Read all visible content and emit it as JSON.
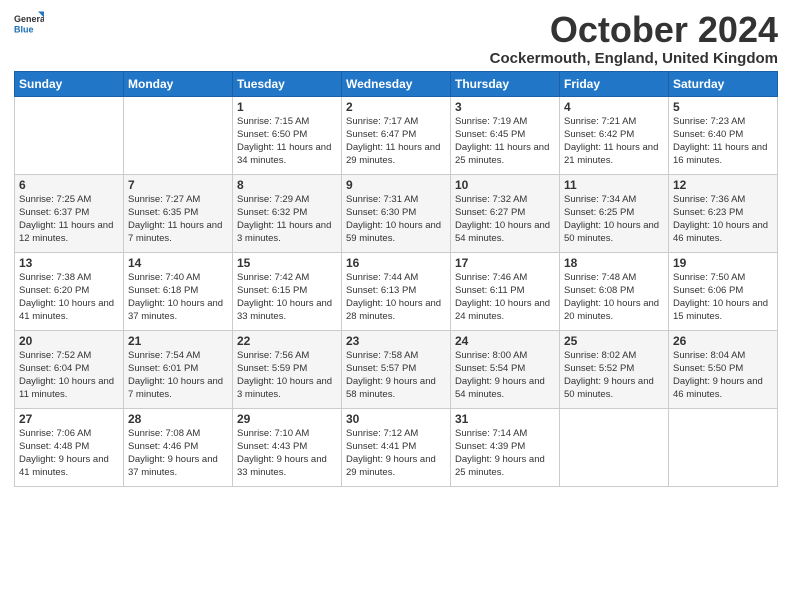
{
  "logo": {
    "line1": "General",
    "line2": "Blue"
  },
  "title": "October 2024",
  "location": "Cockermouth, England, United Kingdom",
  "days_header": [
    "Sunday",
    "Monday",
    "Tuesday",
    "Wednesday",
    "Thursday",
    "Friday",
    "Saturday"
  ],
  "weeks": [
    [
      {
        "day": "",
        "sunrise": "",
        "sunset": "",
        "daylight": ""
      },
      {
        "day": "",
        "sunrise": "",
        "sunset": "",
        "daylight": ""
      },
      {
        "day": "1",
        "sunrise": "Sunrise: 7:15 AM",
        "sunset": "Sunset: 6:50 PM",
        "daylight": "Daylight: 11 hours and 34 minutes."
      },
      {
        "day": "2",
        "sunrise": "Sunrise: 7:17 AM",
        "sunset": "Sunset: 6:47 PM",
        "daylight": "Daylight: 11 hours and 29 minutes."
      },
      {
        "day": "3",
        "sunrise": "Sunrise: 7:19 AM",
        "sunset": "Sunset: 6:45 PM",
        "daylight": "Daylight: 11 hours and 25 minutes."
      },
      {
        "day": "4",
        "sunrise": "Sunrise: 7:21 AM",
        "sunset": "Sunset: 6:42 PM",
        "daylight": "Daylight: 11 hours and 21 minutes."
      },
      {
        "day": "5",
        "sunrise": "Sunrise: 7:23 AM",
        "sunset": "Sunset: 6:40 PM",
        "daylight": "Daylight: 11 hours and 16 minutes."
      }
    ],
    [
      {
        "day": "6",
        "sunrise": "Sunrise: 7:25 AM",
        "sunset": "Sunset: 6:37 PM",
        "daylight": "Daylight: 11 hours and 12 minutes."
      },
      {
        "day": "7",
        "sunrise": "Sunrise: 7:27 AM",
        "sunset": "Sunset: 6:35 PM",
        "daylight": "Daylight: 11 hours and 7 minutes."
      },
      {
        "day": "8",
        "sunrise": "Sunrise: 7:29 AM",
        "sunset": "Sunset: 6:32 PM",
        "daylight": "Daylight: 11 hours and 3 minutes."
      },
      {
        "day": "9",
        "sunrise": "Sunrise: 7:31 AM",
        "sunset": "Sunset: 6:30 PM",
        "daylight": "Daylight: 10 hours and 59 minutes."
      },
      {
        "day": "10",
        "sunrise": "Sunrise: 7:32 AM",
        "sunset": "Sunset: 6:27 PM",
        "daylight": "Daylight: 10 hours and 54 minutes."
      },
      {
        "day": "11",
        "sunrise": "Sunrise: 7:34 AM",
        "sunset": "Sunset: 6:25 PM",
        "daylight": "Daylight: 10 hours and 50 minutes."
      },
      {
        "day": "12",
        "sunrise": "Sunrise: 7:36 AM",
        "sunset": "Sunset: 6:23 PM",
        "daylight": "Daylight: 10 hours and 46 minutes."
      }
    ],
    [
      {
        "day": "13",
        "sunrise": "Sunrise: 7:38 AM",
        "sunset": "Sunset: 6:20 PM",
        "daylight": "Daylight: 10 hours and 41 minutes."
      },
      {
        "day": "14",
        "sunrise": "Sunrise: 7:40 AM",
        "sunset": "Sunset: 6:18 PM",
        "daylight": "Daylight: 10 hours and 37 minutes."
      },
      {
        "day": "15",
        "sunrise": "Sunrise: 7:42 AM",
        "sunset": "Sunset: 6:15 PM",
        "daylight": "Daylight: 10 hours and 33 minutes."
      },
      {
        "day": "16",
        "sunrise": "Sunrise: 7:44 AM",
        "sunset": "Sunset: 6:13 PM",
        "daylight": "Daylight: 10 hours and 28 minutes."
      },
      {
        "day": "17",
        "sunrise": "Sunrise: 7:46 AM",
        "sunset": "Sunset: 6:11 PM",
        "daylight": "Daylight: 10 hours and 24 minutes."
      },
      {
        "day": "18",
        "sunrise": "Sunrise: 7:48 AM",
        "sunset": "Sunset: 6:08 PM",
        "daylight": "Daylight: 10 hours and 20 minutes."
      },
      {
        "day": "19",
        "sunrise": "Sunrise: 7:50 AM",
        "sunset": "Sunset: 6:06 PM",
        "daylight": "Daylight: 10 hours and 15 minutes."
      }
    ],
    [
      {
        "day": "20",
        "sunrise": "Sunrise: 7:52 AM",
        "sunset": "Sunset: 6:04 PM",
        "daylight": "Daylight: 10 hours and 11 minutes."
      },
      {
        "day": "21",
        "sunrise": "Sunrise: 7:54 AM",
        "sunset": "Sunset: 6:01 PM",
        "daylight": "Daylight: 10 hours and 7 minutes."
      },
      {
        "day": "22",
        "sunrise": "Sunrise: 7:56 AM",
        "sunset": "Sunset: 5:59 PM",
        "daylight": "Daylight: 10 hours and 3 minutes."
      },
      {
        "day": "23",
        "sunrise": "Sunrise: 7:58 AM",
        "sunset": "Sunset: 5:57 PM",
        "daylight": "Daylight: 9 hours and 58 minutes."
      },
      {
        "day": "24",
        "sunrise": "Sunrise: 8:00 AM",
        "sunset": "Sunset: 5:54 PM",
        "daylight": "Daylight: 9 hours and 54 minutes."
      },
      {
        "day": "25",
        "sunrise": "Sunrise: 8:02 AM",
        "sunset": "Sunset: 5:52 PM",
        "daylight": "Daylight: 9 hours and 50 minutes."
      },
      {
        "day": "26",
        "sunrise": "Sunrise: 8:04 AM",
        "sunset": "Sunset: 5:50 PM",
        "daylight": "Daylight: 9 hours and 46 minutes."
      }
    ],
    [
      {
        "day": "27",
        "sunrise": "Sunrise: 7:06 AM",
        "sunset": "Sunset: 4:48 PM",
        "daylight": "Daylight: 9 hours and 41 minutes."
      },
      {
        "day": "28",
        "sunrise": "Sunrise: 7:08 AM",
        "sunset": "Sunset: 4:46 PM",
        "daylight": "Daylight: 9 hours and 37 minutes."
      },
      {
        "day": "29",
        "sunrise": "Sunrise: 7:10 AM",
        "sunset": "Sunset: 4:43 PM",
        "daylight": "Daylight: 9 hours and 33 minutes."
      },
      {
        "day": "30",
        "sunrise": "Sunrise: 7:12 AM",
        "sunset": "Sunset: 4:41 PM",
        "daylight": "Daylight: 9 hours and 29 minutes."
      },
      {
        "day": "31",
        "sunrise": "Sunrise: 7:14 AM",
        "sunset": "Sunset: 4:39 PM",
        "daylight": "Daylight: 9 hours and 25 minutes."
      },
      {
        "day": "",
        "sunrise": "",
        "sunset": "",
        "daylight": ""
      },
      {
        "day": "",
        "sunrise": "",
        "sunset": "",
        "daylight": ""
      }
    ]
  ]
}
